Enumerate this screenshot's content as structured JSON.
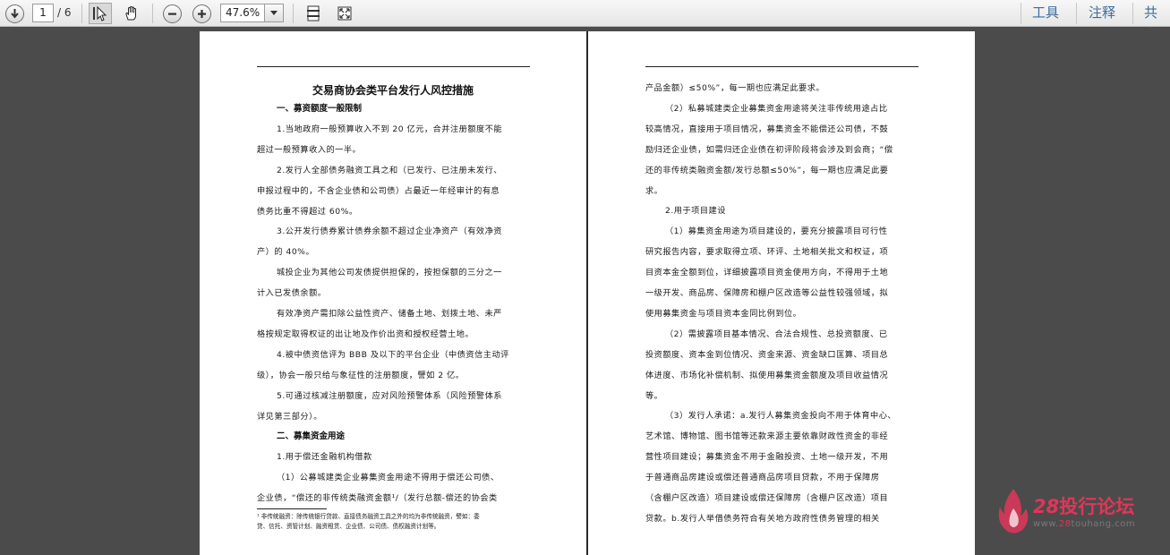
{
  "toolbar": {
    "page_current": "1",
    "page_total": "/ 6",
    "zoom": "47.6%",
    "tools_label": "工具",
    "comment_label": "注释",
    "share_label": "共享"
  },
  "doc": {
    "title": "交易商协会类平台发行人风控措施",
    "left_lines": [
      {
        "t": "h",
        "text": "一、募资额度一般限制"
      },
      {
        "t": "p",
        "text": "1.当地政府一般预算收入不到 20 亿元，合并注册额度不能"
      },
      {
        "t": "c",
        "text": "超过一般预算收入的一半。"
      },
      {
        "t": "p",
        "text": "2.发行人全部债务融资工具之和（已发行、已注册未发行、"
      },
      {
        "t": "c",
        "text": "申报过程中的，不含企业债和公司债）占最近一年经审计的有息"
      },
      {
        "t": "c",
        "text": "债务比重不得超过 60%。"
      },
      {
        "t": "p",
        "text": "3.公开发行债券累计债券余额不超过企业净资产（有效净资"
      },
      {
        "t": "c",
        "text": "产）的 40%。"
      },
      {
        "t": "p",
        "text": "城投企业为其他公司发债提供担保的，按担保额的三分之一"
      },
      {
        "t": "c",
        "text": "计入已发债余额。"
      },
      {
        "t": "p",
        "text": "有效净资产需扣除公益性资产、储备土地、划拨土地、未严"
      },
      {
        "t": "c",
        "text": "格按规定取得权证的出让地及作价出资和授权经营土地。"
      },
      {
        "t": "p",
        "text": "4.被中债资信评为 BBB 及以下的平台企业（中债资信主动评"
      },
      {
        "t": "c",
        "text": "级），协会一般只给与象征性的注册额度，譬如 2 亿。"
      },
      {
        "t": "p",
        "text": "5.可通过核减注册额度，应对风险预警体系（风险预警体系"
      },
      {
        "t": "c",
        "text": "详见第三部分）。"
      },
      {
        "t": "h",
        "text": "二、募集资金用途"
      },
      {
        "t": "p",
        "text": "1.用于偿还金融机构借款"
      },
      {
        "t": "p",
        "text": "（1）公募城建类企业募集资金用途不得用于偿还公司债、"
      },
      {
        "t": "c",
        "text": "企业债，“偿还的非传统类融资金额¹/（发行总额-偿还的协会类"
      }
    ],
    "footnote_lines": [
      "¹ 非传统融资：除传统银行贷款、直接债务融资工具之外的均为非传统融资，譬如：委",
      "贷、信托、资管计划、融资租赁、企业债、公司债、债权融资计划等。"
    ],
    "right_lines": [
      {
        "t": "c",
        "text": "产品金额）≤50%”，每一期也应满足此要求。"
      },
      {
        "t": "p",
        "text": "（2）私募城建类企业募集资金用途将关注非传统用途占比"
      },
      {
        "t": "c",
        "text": "较高情况，直接用于项目情况，募集资金不能偿还公司债，不鼓"
      },
      {
        "t": "c",
        "text": "励归还企业债，如需归还企业债在初评阶段将会涉及到会商；“偿"
      },
      {
        "t": "c",
        "text": "还的非传统类融资金额/发行总额≤50%”，每一期也应满足此要"
      },
      {
        "t": "c",
        "text": "求。"
      },
      {
        "t": "p",
        "text": "2.用于项目建设"
      },
      {
        "t": "p",
        "text": "（1）募集资金用途为项目建设的，要充分披露项目可行性"
      },
      {
        "t": "c",
        "text": "研究报告内容，要求取得立项、环评、土地相关批文和权证，项"
      },
      {
        "t": "c",
        "text": "目资本金全额到位，详细披露项目资金使用方向，不得用于土地"
      },
      {
        "t": "c",
        "text": "一级开发、商品房、保障房和棚户区改造等公益性较强领域，拟"
      },
      {
        "t": "c",
        "text": "使用募集资金与项目资本金同比例到位。"
      },
      {
        "t": "p",
        "text": "（2）需披露项目基本情况、合法合规性、总投资额度、已"
      },
      {
        "t": "c",
        "text": "投资额度、资本金到位情况、资金来源、资金缺口匡算、项目总"
      },
      {
        "t": "c",
        "text": "体进度、市场化补偿机制、拟使用募集资金额度及项目收益情况"
      },
      {
        "t": "c",
        "text": "等。"
      },
      {
        "t": "p",
        "text": "（3）发行人承诺：a.发行人募集资金投向不用于体育中心、"
      },
      {
        "t": "c",
        "text": "艺术馆、博物馆、图书馆等还款来源主要依靠财政性资金的非经"
      },
      {
        "t": "c",
        "text": "营性项目建设；募集资金不用于金融投资、土地一级开发，不用"
      },
      {
        "t": "c",
        "text": "于普通商品房建设或偿还普通商品房项目贷款，不用于保障房"
      },
      {
        "t": "c",
        "text": "（含棚户区改造）项目建设或偿还保障房（含棚户区改造）项目"
      },
      {
        "t": "c",
        "text": "贷款。b.发行人举借债务符合有关地方政府性债务管理的相关"
      }
    ]
  },
  "watermark": {
    "num": "28",
    "name": "投行论坛",
    "url_pre": "www.",
    "url_hl": "28",
    "url_post": "touhang.com",
    "color": "#e0365a"
  }
}
